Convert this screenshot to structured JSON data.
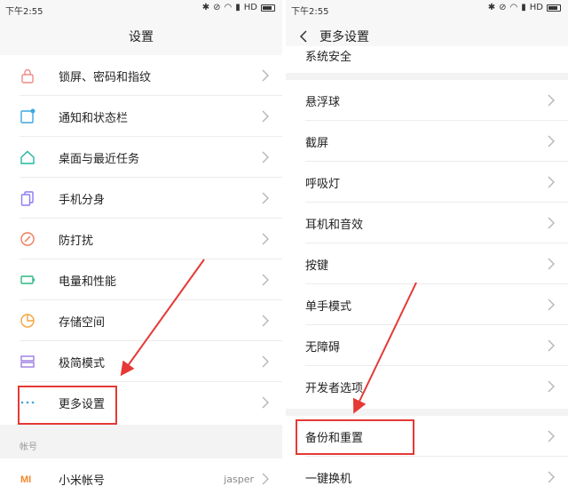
{
  "status": {
    "time": "下午2:55",
    "network": "HD"
  },
  "left": {
    "title": "设置",
    "items": [
      {
        "label": "锁屏、密码和指纹",
        "icon": "lock-icon",
        "color": "#f08a8a"
      },
      {
        "label": "通知和状态栏",
        "icon": "notification-icon",
        "color": "#3aa7e0"
      },
      {
        "label": "桌面与最近任务",
        "icon": "home-icon",
        "color": "#22b5a0"
      },
      {
        "label": "手机分身",
        "icon": "dual-phone-icon",
        "color": "#8a7cf0"
      },
      {
        "label": "防打扰",
        "icon": "do-not-disturb-icon",
        "color": "#f07a5a"
      },
      {
        "label": "电量和性能",
        "icon": "battery-icon",
        "color": "#2fb882"
      },
      {
        "label": "存储空间",
        "icon": "storage-icon",
        "color": "#f5a23a"
      },
      {
        "label": "极简模式",
        "icon": "simple-mode-icon",
        "color": "#9b7ce0"
      },
      {
        "label": "更多设置",
        "icon": "more-icon",
        "color": "#3aa7e0"
      }
    ],
    "account_section": "帐号",
    "account": {
      "label": "小米帐号",
      "icon": "mi-logo-icon",
      "value": "jasper",
      "color": "#f5862a"
    }
  },
  "right": {
    "title": "更多设置",
    "top_item": "系统安全",
    "items": [
      "悬浮球",
      "截屏",
      "呼吸灯",
      "耳机和音效",
      "按键",
      "单手模式",
      "无障碍",
      "开发者选项"
    ],
    "items2": [
      "备份和重置",
      "一键换机"
    ]
  },
  "colors": {
    "highlight": "#e53935",
    "chevron": "#b5b5b5"
  }
}
